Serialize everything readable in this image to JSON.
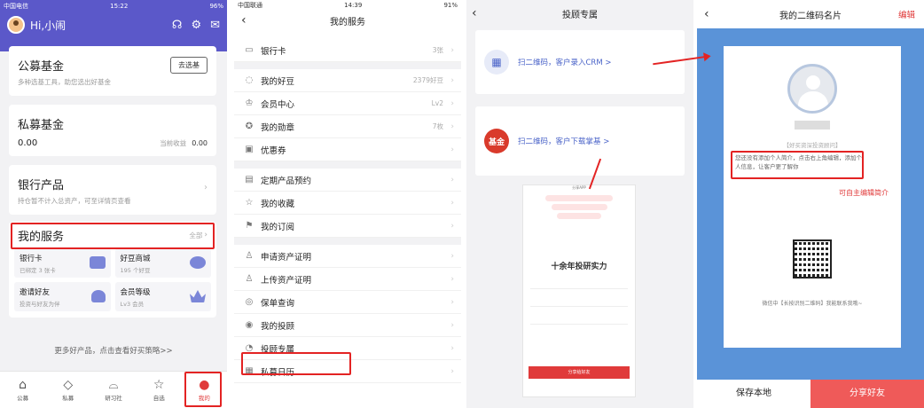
{
  "p1": {
    "status_carrier": "中国电信",
    "status_time": "15:22",
    "status_battery": "96%",
    "greeting": "Hi,小闹",
    "public_fund": {
      "title": "公募基金",
      "sub": "多种选基工具，助您选出好基金",
      "button": "去选基"
    },
    "private_fund": {
      "title": "私募基金",
      "amount": "0.00",
      "income_label": "当前收益",
      "income": "0.00"
    },
    "bank": {
      "title": "银行产品",
      "sub": "持仓暂不计入总资产，可至详情页查看"
    },
    "services": {
      "title": "我的服务",
      "all": "全部",
      "items": [
        {
          "name": "银行卡",
          "desc": "已绑定 3 张卡"
        },
        {
          "name": "好豆商城",
          "desc": "195 个好豆"
        },
        {
          "name": "邀请好友",
          "desc": "投资与好友为伴"
        },
        {
          "name": "会员等级",
          "desc": "Lv3 会员"
        }
      ]
    },
    "more": "更多好产品，点击查看好买策略>>",
    "tabs": [
      "公募",
      "私募",
      "研习社",
      "自选",
      "我的"
    ]
  },
  "p2": {
    "status_carrier": "中国联通",
    "status_time": "14:39",
    "status_battery": "91%",
    "title": "我的服务",
    "rows": [
      {
        "label": "银行卡",
        "value": "3张"
      },
      {
        "label": "我的好豆",
        "value": "2379好豆"
      },
      {
        "label": "会员中心",
        "value": "Lv2"
      },
      {
        "label": "我的勋章",
        "value": "7枚"
      },
      {
        "label": "优惠券",
        "value": ""
      },
      {
        "label": "定期产品预约",
        "value": ""
      },
      {
        "label": "我的收藏",
        "value": ""
      },
      {
        "label": "我的订阅",
        "value": ""
      },
      {
        "label": "申请资产证明",
        "value": ""
      },
      {
        "label": "上传资产证明",
        "value": ""
      },
      {
        "label": "保单查询",
        "value": ""
      },
      {
        "label": "我的投顾",
        "value": ""
      },
      {
        "label": "投顾专属",
        "value": ""
      },
      {
        "label": "私募日历",
        "value": ""
      }
    ]
  },
  "p3": {
    "title": "投顾专属",
    "card1": "扫二维码，客户录入CRM >",
    "card2": "扫二维码，客户下载掌基 >",
    "brand": "基金",
    "mini_title": "分享APP",
    "mini_big": "十余年投研实力",
    "mini_share": "分享给好友"
  },
  "p4": {
    "title": "我的二维码名片",
    "edit": "编辑",
    "tag": "【好买资深投资顾问】",
    "intro": "您还没有添加个人简介，点击右上角编辑，添加个人信息，让客户更了解你",
    "hint": "可自主编辑简介",
    "wechat": "微信中【长按识别二维码】我能联系我哦~",
    "save": "保存本地",
    "share": "分享好友"
  }
}
